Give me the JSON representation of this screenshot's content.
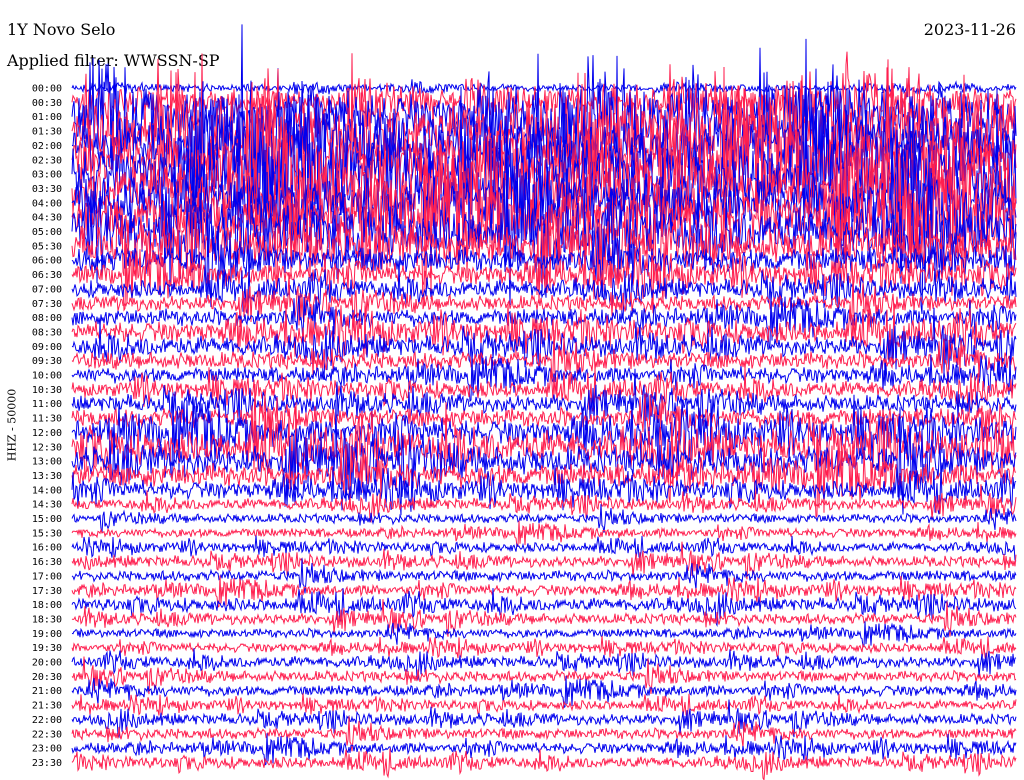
{
  "header": {
    "station": "1Y Novo Selo",
    "date": "2023-11-26",
    "filter": "Applied filter: WWSSN-SP"
  },
  "channel_label": "HHZ - 50000",
  "colors": {
    "trace_a": "#0000ee",
    "trace_b": "#ff1f4f",
    "text": "#000000",
    "background": "#ffffff"
  },
  "chart_data": {
    "type": "line",
    "title": "1Y Novo Selo",
    "ylabel": "HHZ - 50000",
    "row_labels": [
      "00:00",
      "00:30",
      "01:00",
      "01:30",
      "02:00",
      "02:30",
      "03:00",
      "03:30",
      "04:00",
      "04:30",
      "05:00",
      "05:30",
      "06:00",
      "06:30",
      "07:00",
      "07:30",
      "08:00",
      "08:30",
      "09:00",
      "09:30",
      "10:00",
      "10:30",
      "11:00",
      "11:30",
      "12:00",
      "12:30",
      "13:00",
      "13:30",
      "14:00",
      "14:30",
      "15:00",
      "15:30",
      "16:00",
      "16:30",
      "17:00",
      "17:30",
      "18:00",
      "18:30",
      "19:00",
      "19:30",
      "20:00",
      "20:30",
      "21:00",
      "21:30",
      "22:00",
      "22:30",
      "23:00",
      "23:30"
    ],
    "series_colors": [
      "#0000ee",
      "#ff1f4f"
    ],
    "relative_amplitude": [
      0.3,
      1.4,
      2.6,
      3.0,
      3.2,
      3.3,
      3.3,
      3.2,
      3.1,
      2.9,
      2.5,
      2.0,
      1.4,
      1.1,
      0.9,
      0.8,
      0.9,
      1.1,
      1.0,
      0.9,
      0.8,
      0.8,
      0.9,
      1.0,
      1.4,
      1.7,
      1.6,
      1.3,
      0.9,
      0.5,
      0.4,
      0.4,
      0.4,
      0.5,
      0.5,
      0.5,
      0.6,
      0.5,
      0.4,
      0.4,
      0.5,
      0.5,
      0.5,
      0.4,
      0.5,
      0.5,
      0.5,
      0.5
    ]
  }
}
